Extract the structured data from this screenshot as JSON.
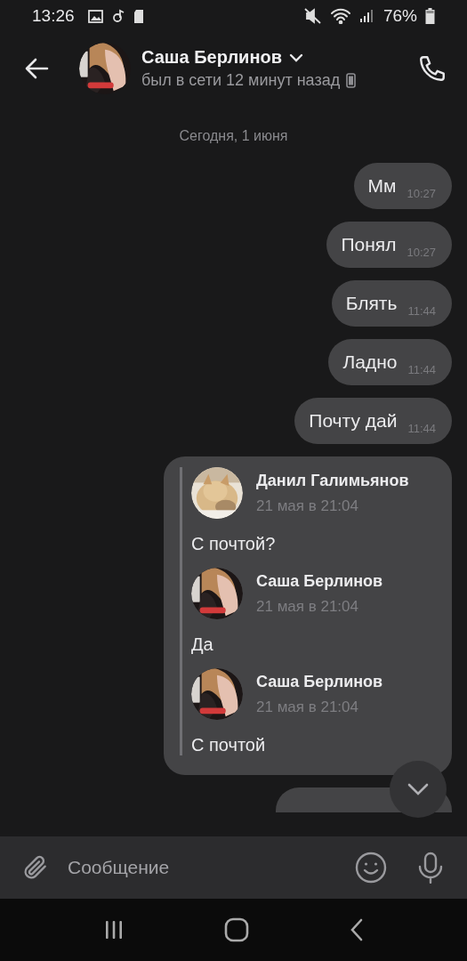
{
  "status_bar": {
    "time": "13:26",
    "battery": "76%"
  },
  "header": {
    "name": "Саша Берлинов",
    "status": "был в сети 12 минут назад"
  },
  "date_separator": "Сегодня, 1 июня",
  "messages": [
    {
      "kind": "text",
      "text": "Мм",
      "time": "10:27"
    },
    {
      "kind": "text",
      "text": "Понял",
      "time": "10:27"
    },
    {
      "kind": "text",
      "text": "Блять",
      "time": "11:44"
    },
    {
      "kind": "text",
      "text": "Ладно",
      "time": "11:44"
    },
    {
      "kind": "text",
      "text": "Почту дай",
      "time": "11:44"
    },
    {
      "kind": "forwarded",
      "items": [
        {
          "author": "Данил Галимьянов",
          "date": "21 мая в 21:04",
          "text": "С почтой?"
        },
        {
          "author": "Саша Берлинов",
          "date": "21 мая в 21:04",
          "text": "Да"
        },
        {
          "author": "Саша Берлинов",
          "date": "21 мая в 21:04",
          "text": "С почтой"
        }
      ]
    },
    {
      "kind": "cut_off"
    }
  ],
  "composer": {
    "placeholder": "Сообщение"
  }
}
